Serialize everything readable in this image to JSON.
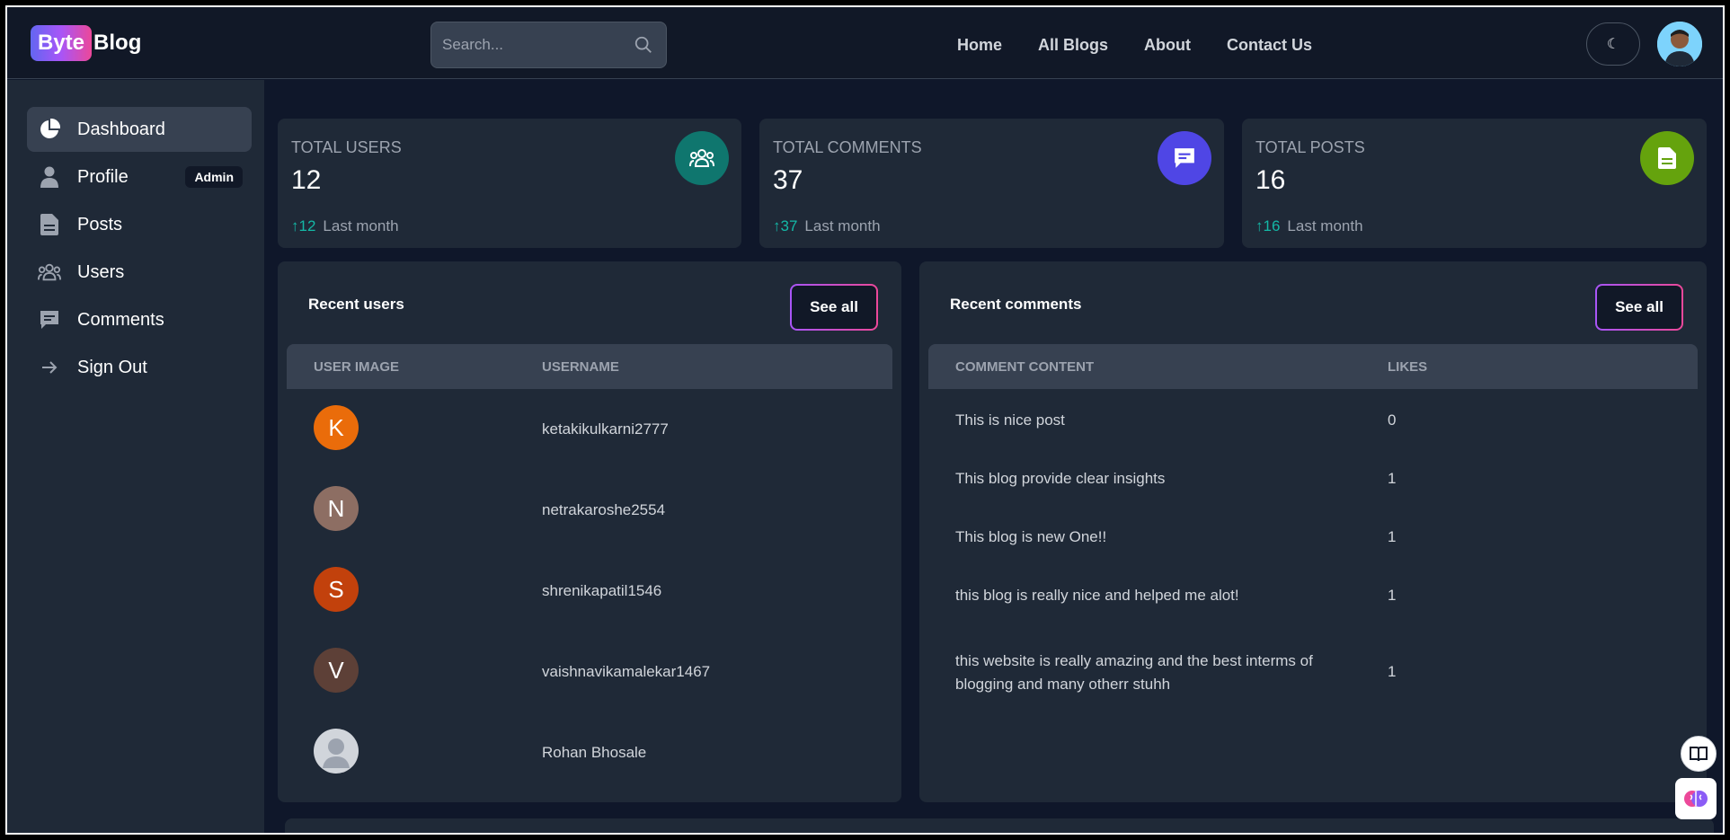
{
  "header": {
    "logo_byte": "Byte",
    "logo_blog": "Blog",
    "search_placeholder": "Search...",
    "nav": [
      "Home",
      "All Blogs",
      "About",
      "Contact Us"
    ]
  },
  "sidebar": {
    "items": [
      {
        "label": "Dashboard",
        "icon": "pie-chart-icon"
      },
      {
        "label": "Profile",
        "icon": "user-icon",
        "badge": "Admin"
      },
      {
        "label": "Posts",
        "icon": "document-icon"
      },
      {
        "label": "Users",
        "icon": "users-icon"
      },
      {
        "label": "Comments",
        "icon": "comment-icon"
      },
      {
        "label": "Sign Out",
        "icon": "arrow-right-icon"
      }
    ]
  },
  "stats": [
    {
      "label": "Total Users",
      "value": "12",
      "trend_value": "12",
      "trend_label": "Last month",
      "color": "#0f766e",
      "icon": "users-icon"
    },
    {
      "label": "Total Comments",
      "value": "37",
      "trend_value": "37",
      "trend_label": "Last month",
      "color": "#4f46e5",
      "icon": "comment-icon"
    },
    {
      "label": "Total Posts",
      "value": "16",
      "trend_value": "16",
      "trend_label": "Last month",
      "color": "#65a30d",
      "icon": "document-icon"
    }
  ],
  "recent_users": {
    "title": "Recent users",
    "see_all": "See all",
    "columns": [
      "User Image",
      "Username"
    ],
    "rows": [
      {
        "initial": "K",
        "color": "#ea6c0a",
        "username": "ketakikulkarni2777"
      },
      {
        "initial": "N",
        "color": "#8d6e63",
        "username": "netrakaroshe2554"
      },
      {
        "initial": "S",
        "color": "#c2410c",
        "username": "shrenikapatil1546"
      },
      {
        "initial": "V",
        "color": "#5d4037",
        "username": "vaishnavikamalekar1467"
      },
      {
        "initial": "",
        "color": "#d1d5db",
        "username": "Rohan Bhosale"
      }
    ]
  },
  "recent_comments": {
    "title": "Recent comments",
    "see_all": "See all",
    "columns": [
      "Comment Content",
      "Likes"
    ],
    "rows": [
      {
        "content": "This is nice post",
        "likes": "0"
      },
      {
        "content": "This blog provide clear insights",
        "likes": "1"
      },
      {
        "content": "This blog is new One!!",
        "likes": "1"
      },
      {
        "content": "this blog is really nice and helped me alot!",
        "likes": "1"
      },
      {
        "content": "this website is really amazing and the best interms of blogging and many otherr stuhh",
        "likes": "1"
      }
    ]
  }
}
